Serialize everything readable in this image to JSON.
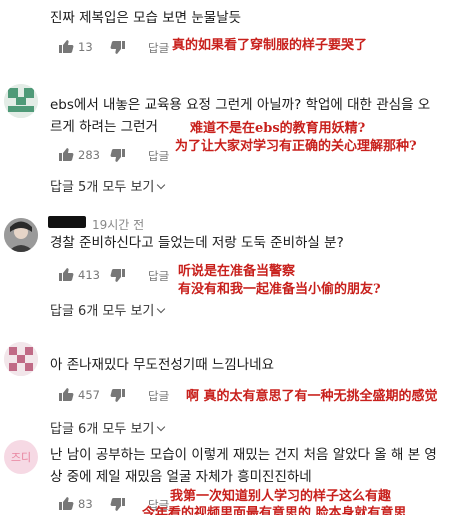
{
  "comments": [
    {
      "text_lines": [
        "진짜 제복입은 모습 보면 눈물날듯"
      ],
      "likes": "13",
      "reply_label": "답글",
      "note_lines": [
        "真的如果看了穿制服的样子要哭了"
      ]
    },
    {
      "text_lines": [
        "ebs에서 내놓은 교육용 요정 그런게 아닐까? 학업에 대한 관심을 오",
        "르게 하려는 그런거"
      ],
      "likes": "283",
      "reply_label": "답글",
      "note_lines": [
        "难道不是在ebs的教育用妖精?",
        "为了让大家对学习有正确的关心理解那种?"
      ],
      "view_replies": "답글 5개 모두 보기"
    },
    {
      "timestamp": "19시간 전",
      "text_lines": [
        "경찰 준비하신다고 들었는데 저랑 도둑 준비하실 분?"
      ],
      "likes": "413",
      "reply_label": "답글",
      "note_lines": [
        "听说是在准备当警察",
        "有没有和我一起准备当小偷的朋友?"
      ],
      "view_replies": "답글 6개 모두 보기"
    },
    {
      "text_lines": [
        "아 존나재밌다 무도전성기때 느낌나네요"
      ],
      "likes": "457",
      "reply_label": "답글",
      "note_lines": [
        "啊 真的太有意思了有一种无挑全盛期的感觉"
      ],
      "view_replies": "답글 6개 모두 보기"
    },
    {
      "avatar_text": "즈디",
      "text_lines": [
        "난 남이 공부하는 모습이 이렇게 재밌는 건지 처음 알았다 올 해 본 영",
        "상 중에 제일 재밌음 얼굴 자체가 흥미진진하네"
      ],
      "likes": "83",
      "reply_label": "답글",
      "note_lines": [
        "我第一次知道别人学习的样子这么有趣",
        "今年看的视频里面最有意思的 脸本身就有意思"
      ]
    }
  ],
  "colors": {
    "annotation_red": "#c8201c",
    "meta_gray": "#888888"
  },
  "icons": {
    "like": "thumbs-up-icon",
    "dislike": "thumbs-down-icon",
    "expand": "chevron-down-icon"
  }
}
